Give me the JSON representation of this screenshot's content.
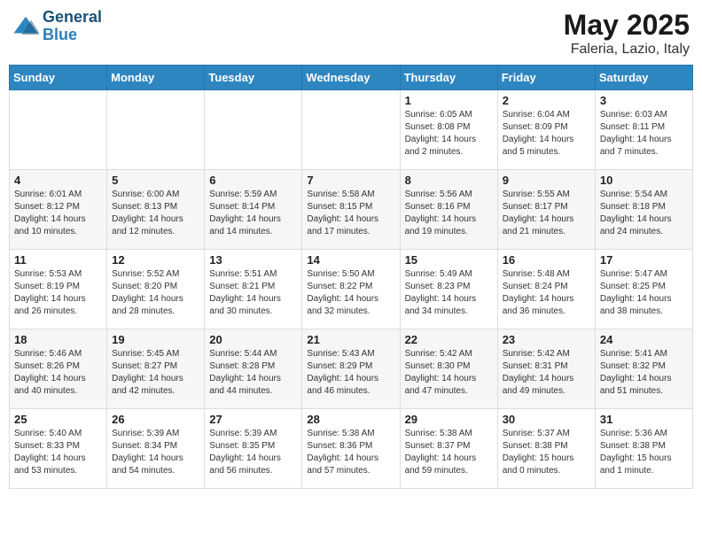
{
  "logo": {
    "line1": "General",
    "line2": "Blue"
  },
  "title": "May 2025",
  "subtitle": "Faleria, Lazio, Italy",
  "headers": [
    "Sunday",
    "Monday",
    "Tuesday",
    "Wednesday",
    "Thursday",
    "Friday",
    "Saturday"
  ],
  "weeks": [
    [
      {
        "num": "",
        "info": ""
      },
      {
        "num": "",
        "info": ""
      },
      {
        "num": "",
        "info": ""
      },
      {
        "num": "",
        "info": ""
      },
      {
        "num": "1",
        "info": "Sunrise: 6:05 AM\nSunset: 8:08 PM\nDaylight: 14 hours and 2 minutes."
      },
      {
        "num": "2",
        "info": "Sunrise: 6:04 AM\nSunset: 8:09 PM\nDaylight: 14 hours and 5 minutes."
      },
      {
        "num": "3",
        "info": "Sunrise: 6:03 AM\nSunset: 8:11 PM\nDaylight: 14 hours and 7 minutes."
      }
    ],
    [
      {
        "num": "4",
        "info": "Sunrise: 6:01 AM\nSunset: 8:12 PM\nDaylight: 14 hours and 10 minutes."
      },
      {
        "num": "5",
        "info": "Sunrise: 6:00 AM\nSunset: 8:13 PM\nDaylight: 14 hours and 12 minutes."
      },
      {
        "num": "6",
        "info": "Sunrise: 5:59 AM\nSunset: 8:14 PM\nDaylight: 14 hours and 14 minutes."
      },
      {
        "num": "7",
        "info": "Sunrise: 5:58 AM\nSunset: 8:15 PM\nDaylight: 14 hours and 17 minutes."
      },
      {
        "num": "8",
        "info": "Sunrise: 5:56 AM\nSunset: 8:16 PM\nDaylight: 14 hours and 19 minutes."
      },
      {
        "num": "9",
        "info": "Sunrise: 5:55 AM\nSunset: 8:17 PM\nDaylight: 14 hours and 21 minutes."
      },
      {
        "num": "10",
        "info": "Sunrise: 5:54 AM\nSunset: 8:18 PM\nDaylight: 14 hours and 24 minutes."
      }
    ],
    [
      {
        "num": "11",
        "info": "Sunrise: 5:53 AM\nSunset: 8:19 PM\nDaylight: 14 hours and 26 minutes."
      },
      {
        "num": "12",
        "info": "Sunrise: 5:52 AM\nSunset: 8:20 PM\nDaylight: 14 hours and 28 minutes."
      },
      {
        "num": "13",
        "info": "Sunrise: 5:51 AM\nSunset: 8:21 PM\nDaylight: 14 hours and 30 minutes."
      },
      {
        "num": "14",
        "info": "Sunrise: 5:50 AM\nSunset: 8:22 PM\nDaylight: 14 hours and 32 minutes."
      },
      {
        "num": "15",
        "info": "Sunrise: 5:49 AM\nSunset: 8:23 PM\nDaylight: 14 hours and 34 minutes."
      },
      {
        "num": "16",
        "info": "Sunrise: 5:48 AM\nSunset: 8:24 PM\nDaylight: 14 hours and 36 minutes."
      },
      {
        "num": "17",
        "info": "Sunrise: 5:47 AM\nSunset: 8:25 PM\nDaylight: 14 hours and 38 minutes."
      }
    ],
    [
      {
        "num": "18",
        "info": "Sunrise: 5:46 AM\nSunset: 8:26 PM\nDaylight: 14 hours and 40 minutes."
      },
      {
        "num": "19",
        "info": "Sunrise: 5:45 AM\nSunset: 8:27 PM\nDaylight: 14 hours and 42 minutes."
      },
      {
        "num": "20",
        "info": "Sunrise: 5:44 AM\nSunset: 8:28 PM\nDaylight: 14 hours and 44 minutes."
      },
      {
        "num": "21",
        "info": "Sunrise: 5:43 AM\nSunset: 8:29 PM\nDaylight: 14 hours and 46 minutes."
      },
      {
        "num": "22",
        "info": "Sunrise: 5:42 AM\nSunset: 8:30 PM\nDaylight: 14 hours and 47 minutes."
      },
      {
        "num": "23",
        "info": "Sunrise: 5:42 AM\nSunset: 8:31 PM\nDaylight: 14 hours and 49 minutes."
      },
      {
        "num": "24",
        "info": "Sunrise: 5:41 AM\nSunset: 8:32 PM\nDaylight: 14 hours and 51 minutes."
      }
    ],
    [
      {
        "num": "25",
        "info": "Sunrise: 5:40 AM\nSunset: 8:33 PM\nDaylight: 14 hours and 53 minutes."
      },
      {
        "num": "26",
        "info": "Sunrise: 5:39 AM\nSunset: 8:34 PM\nDaylight: 14 hours and 54 minutes."
      },
      {
        "num": "27",
        "info": "Sunrise: 5:39 AM\nSunset: 8:35 PM\nDaylight: 14 hours and 56 minutes."
      },
      {
        "num": "28",
        "info": "Sunrise: 5:38 AM\nSunset: 8:36 PM\nDaylight: 14 hours and 57 minutes."
      },
      {
        "num": "29",
        "info": "Sunrise: 5:38 AM\nSunset: 8:37 PM\nDaylight: 14 hours and 59 minutes."
      },
      {
        "num": "30",
        "info": "Sunrise: 5:37 AM\nSunset: 8:38 PM\nDaylight: 15 hours and 0 minutes."
      },
      {
        "num": "31",
        "info": "Sunrise: 5:36 AM\nSunset: 8:38 PM\nDaylight: 15 hours and 1 minute."
      }
    ]
  ]
}
